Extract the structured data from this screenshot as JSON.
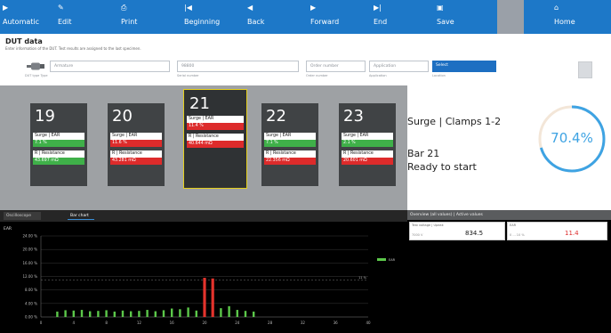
{
  "toolbar": {
    "buttons": [
      {
        "label": "Automatic",
        "icon": "play-icon"
      },
      {
        "label": "Edit",
        "icon": "pencil-icon"
      },
      {
        "label": "Print",
        "icon": "print-icon"
      },
      {
        "label": "Beginning",
        "icon": "skip-back-icon"
      },
      {
        "label": "Back",
        "icon": "back-icon"
      },
      {
        "label": "Forward",
        "icon": "forward-icon"
      },
      {
        "label": "End",
        "icon": "skip-end-icon"
      },
      {
        "label": "Save",
        "icon": "save-icon"
      },
      {
        "label": "Home",
        "icon": "home-icon"
      }
    ]
  },
  "dut": {
    "title": "DUT data",
    "subtitle": "Enter information of the DUT. Test results are assigned to the last specimen.",
    "fields": [
      {
        "value": "Armature",
        "caption": "DUT type   Type"
      },
      {
        "value": "98800",
        "caption": "Serial number"
      },
      {
        "value": "Order number",
        "caption": "Order number"
      },
      {
        "value": "Application",
        "caption": "Application"
      }
    ],
    "location": {
      "label": "Select",
      "caption": "Location"
    }
  },
  "cards": [
    {
      "number": "19",
      "test1": "Surge | EAR",
      "val1": "7.1 %",
      "val1_state": "pass",
      "test2": "R | Resistance",
      "val2": "43.697 mΩ",
      "val2_state": "pass"
    },
    {
      "number": "20",
      "test1": "Surge | EAR",
      "val1": "11.6 %",
      "val1_state": "fail",
      "test2": "R | Resistance",
      "val2": "43.281 mΩ",
      "val2_state": "fail"
    },
    {
      "number": "21",
      "test1": "Surge | EAR",
      "val1": "11.4 %",
      "val1_state": "fail",
      "test2": "R | Resistance",
      "val2": "40.644 mΩ",
      "val2_state": "fail",
      "selected": true
    },
    {
      "number": "22",
      "test1": "Surge | EAR",
      "val1": "7.1 %",
      "val1_state": "pass",
      "test2": "R | Resistance",
      "val2": "22.356 mΩ",
      "val2_state": "fail"
    },
    {
      "number": "23",
      "test1": "Surge | EAR",
      "val1": "2.1 %",
      "val1_state": "pass",
      "test2": "R | Resistance",
      "val2": "20.601 mΩ",
      "val2_state": "fail"
    }
  ],
  "status": {
    "test_name": "Surge | Clamps 1-2",
    "bar": "Bar 21",
    "state": "Ready to start",
    "progress": 70.4,
    "progress_label": "70.4%"
  },
  "tabs": [
    {
      "label": "Oscilloscope",
      "active": false
    },
    {
      "label": "Bar chart",
      "active": true
    }
  ],
  "chart_data": {
    "type": "bar",
    "ylabel": "EAR",
    "yticks": [
      "24.00 %",
      "20.00 %",
      "16.00 %",
      "12.00 %",
      "8.00 %",
      "4.00 %",
      "0.00 %"
    ],
    "ylim": [
      0,
      24
    ],
    "xticks": [
      "0",
      "4",
      "8",
      "12",
      "16",
      "20",
      "24",
      "28",
      "32",
      "36",
      "40"
    ],
    "xlim": [
      0,
      40
    ],
    "threshold": 11,
    "threshold_label": "11 %",
    "legend": "EAR",
    "x": [
      2,
      3,
      4,
      5,
      6,
      7,
      8,
      9,
      10,
      11,
      12,
      13,
      14,
      15,
      16,
      17,
      18,
      19,
      20,
      21,
      22,
      23,
      24,
      25,
      26
    ],
    "values": [
      1.6,
      2.0,
      1.9,
      2.1,
      1.7,
      1.8,
      2.0,
      1.6,
      1.9,
      1.7,
      1.8,
      2.1,
      1.7,
      2.0,
      2.5,
      2.3,
      2.8,
      1.9,
      11.6,
      11.4,
      2.6,
      3.2,
      2.1,
      1.8,
      1.6
    ],
    "colors": {
      "pass": "#5cc84a",
      "fail": "#e3332c"
    }
  },
  "overview": {
    "title": "Overview (all values) | Active values",
    "items": [
      {
        "caption": "Test voltage | Upeak",
        "sub": "7000 V",
        "value": "834.5",
        "value_color": "#111111"
      },
      {
        "caption": "EAR",
        "sub": "0 ... 10 %",
        "value": "11.4",
        "value_color": "#dd2b2b"
      }
    ]
  },
  "colors": {
    "toolbar": "#1d78c8",
    "pass": "#3fb049",
    "fail": "#dd2b2b",
    "selected_border": "#e4cf1d",
    "gauge": "#3ea3e3"
  }
}
